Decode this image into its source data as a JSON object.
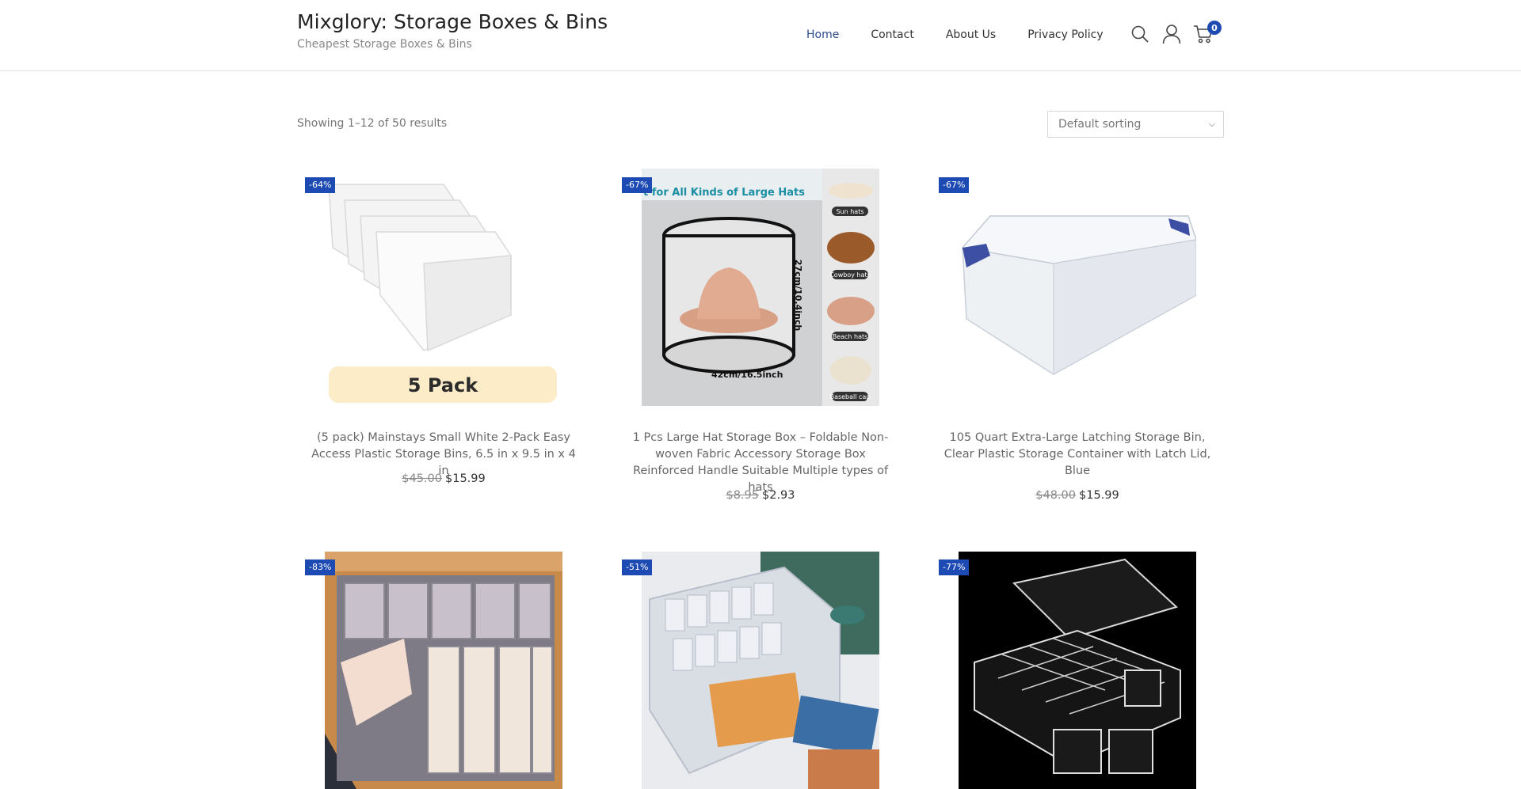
{
  "site": {
    "title": "Mixglory: Storage Boxes & Bins",
    "tagline": "Cheapest Storage Boxes & Bins"
  },
  "nav": {
    "items": [
      {
        "label": "Home",
        "active": true
      },
      {
        "label": "Contact"
      },
      {
        "label": "About Us"
      },
      {
        "label": "Privacy Policy"
      }
    ],
    "icons": [
      "search-icon",
      "user-icon",
      "cart-icon"
    ],
    "cart_count": "0"
  },
  "toolbar": {
    "results": "Showing 1–12 of 50 results",
    "sort_selected": "Default sorting"
  },
  "colors": {
    "accent": "#1e4bb3",
    "nav_active": "#2c4a8a"
  },
  "products": [
    {
      "badge": "-64%",
      "name": "(5 pack) Mainstays Small White 2-Pack Easy Access Plastic Storage Bins, 6.5 in x 9.5 in x 4 in",
      "old_price": "$45.00",
      "price": "$15.99",
      "image_text": "5 Pack"
    },
    {
      "badge": "-67%",
      "name": "1 Pcs Large Hat Storage Box – Foldable Non-woven Fabric Accessory Storage Box Reinforced Handle Suitable Multiple types of hats",
      "old_price": "$8.95",
      "price": "$2.93",
      "image_text": {
        "heading": "t for All Kinds of Large Hats",
        "height": "27cm/10.4inch",
        "width": "42cm/16.5inch",
        "labels": [
          "Sun hats",
          "Cowboy hats",
          "Beach hats",
          "Baseball cap"
        ]
      }
    },
    {
      "badge": "-67%",
      "name": "105 Quart Extra-Large Latching Storage Bin, Clear Plastic Storage Container with Latch Lid, Blue",
      "old_price": "$48.00",
      "price": "$15.99"
    },
    {
      "badge": "-83%"
    },
    {
      "badge": "-51%"
    },
    {
      "badge": "-77%"
    }
  ]
}
